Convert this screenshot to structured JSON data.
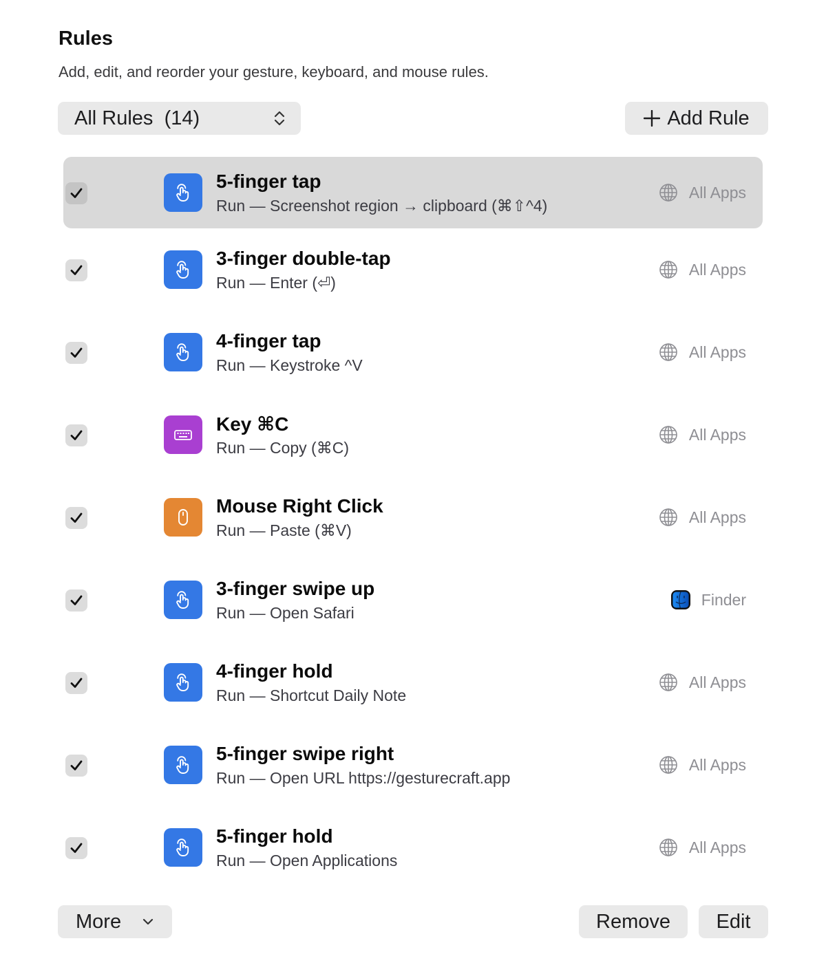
{
  "header": {
    "title": "Rules",
    "subtitle": "Add, edit, and reorder your gesture, keyboard, and mouse rules."
  },
  "filter": {
    "label": "All Rules",
    "count": "(14)"
  },
  "toolbar": {
    "add_label": "Add Rule"
  },
  "colors": {
    "gesture": "#3478e5",
    "keyboard": "#a93fd1",
    "mouse": "#e48733",
    "selected_row": "#d9d9d9"
  },
  "rules": [
    {
      "name": "5-finger tap",
      "action": "Run — Screenshot region → clipboard (⌘⇧^4)",
      "kind": "gesture",
      "icon": "hand-tap-icon",
      "scope": "All Apps",
      "scope_icon": "globe-icon",
      "enabled": true,
      "selected": true
    },
    {
      "name": "3-finger double-tap",
      "action": "Run — Enter (⏎)",
      "kind": "gesture",
      "icon": "hand-tap-icon",
      "scope": "All Apps",
      "scope_icon": "globe-icon",
      "enabled": true,
      "selected": false
    },
    {
      "name": "4-finger tap",
      "action": "Run — Keystroke ^V",
      "kind": "gesture",
      "icon": "hand-tap-icon",
      "scope": "All Apps",
      "scope_icon": "globe-icon",
      "enabled": true,
      "selected": false
    },
    {
      "name": "Key ⌘C",
      "action": "Run — Copy (⌘C)",
      "kind": "keyboard",
      "icon": "keyboard-icon",
      "scope": "All Apps",
      "scope_icon": "globe-icon",
      "enabled": true,
      "selected": false
    },
    {
      "name": "Mouse Right Click",
      "action": "Run — Paste (⌘V)",
      "kind": "mouse",
      "icon": "mouse-icon",
      "scope": "All Apps",
      "scope_icon": "globe-icon",
      "enabled": true,
      "selected": false
    },
    {
      "name": "3-finger swipe up",
      "action": "Run — Open Safari",
      "kind": "gesture",
      "icon": "hand-tap-icon",
      "scope": "Finder",
      "scope_icon": "finder-icon",
      "enabled": true,
      "selected": false
    },
    {
      "name": "4-finger hold",
      "action": "Run — Shortcut Daily Note",
      "kind": "gesture",
      "icon": "hand-tap-icon",
      "scope": "All Apps",
      "scope_icon": "globe-icon",
      "enabled": true,
      "selected": false
    },
    {
      "name": "5-finger swipe right",
      "action": "Run — Open URL https://gesturecraft.app",
      "kind": "gesture",
      "icon": "hand-tap-icon",
      "scope": "All Apps",
      "scope_icon": "globe-icon",
      "enabled": true,
      "selected": false
    },
    {
      "name": "5-finger hold",
      "action": "Run — Open Applications",
      "kind": "gesture",
      "icon": "hand-tap-icon",
      "scope": "All Apps",
      "scope_icon": "globe-icon",
      "enabled": true,
      "selected": false
    }
  ],
  "footer": {
    "more_label": "More",
    "remove_label": "Remove",
    "edit_label": "Edit"
  }
}
